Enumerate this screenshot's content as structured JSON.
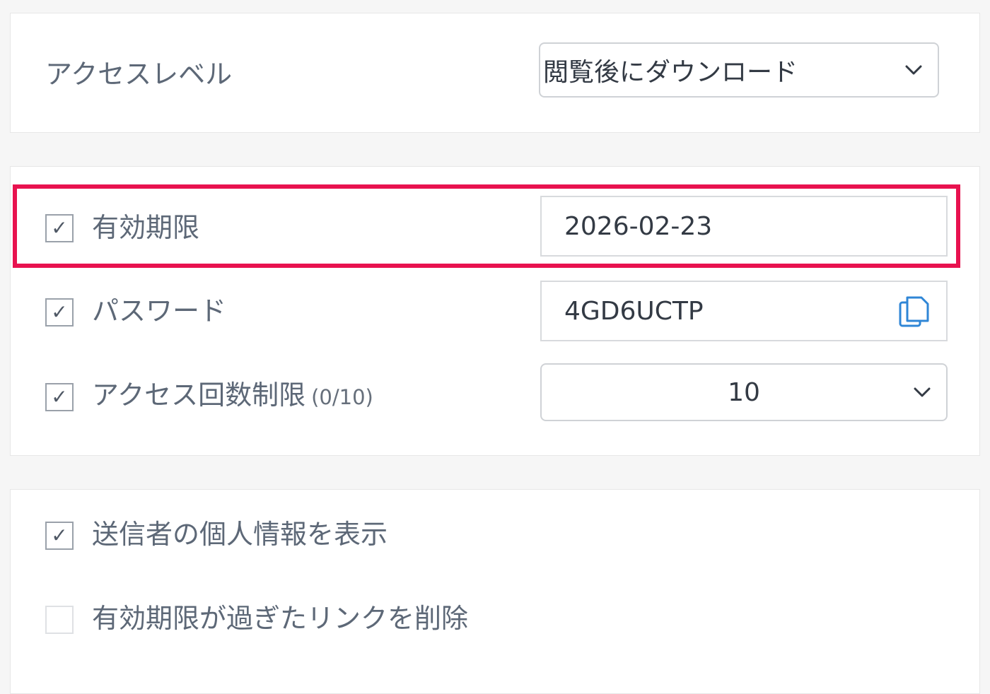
{
  "access_level": {
    "label": "アクセスレベル",
    "selected": "閲覧後にダウンロード",
    "icon": "chevron-down-icon"
  },
  "security": {
    "expiry": {
      "label": "有効期限",
      "checked": true,
      "value": "2026-02-23"
    },
    "password": {
      "label": "パスワード",
      "checked": true,
      "value": "4GD6UCTP",
      "copy_icon": "copy-icon"
    },
    "access_count": {
      "label": "アクセス回数制限",
      "hint": "(0/10)",
      "checked": true,
      "selected": "10"
    }
  },
  "options": {
    "show_sender_info": {
      "label": "送信者の個人情報を表示",
      "checked": true
    },
    "delete_expired": {
      "label": "有効期限が過ぎたリンクを削除",
      "checked": false
    }
  },
  "colors": {
    "highlight": "#e8124f",
    "icon_blue": "#2f86d6"
  },
  "glyphs": {
    "check": "✓"
  }
}
